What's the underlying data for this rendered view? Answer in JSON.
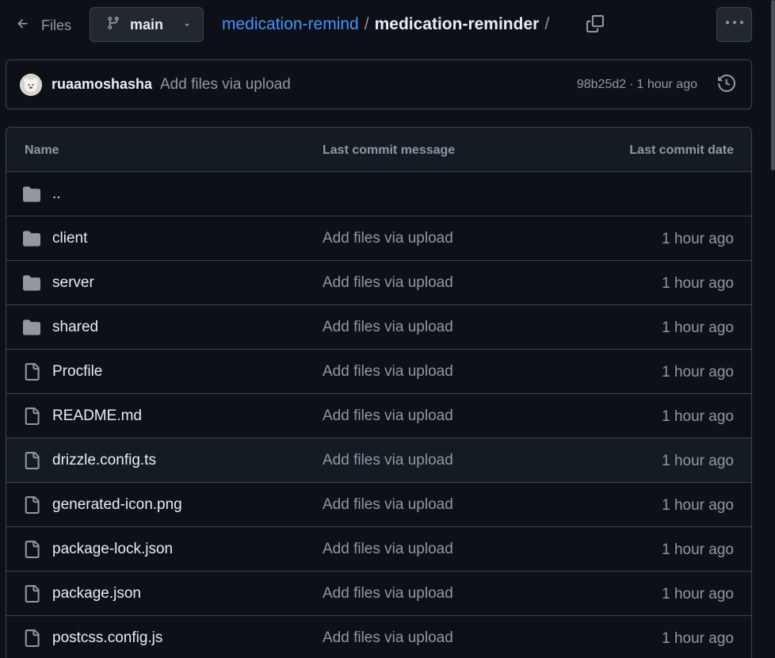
{
  "topbar": {
    "back_label": "Files",
    "branch": "main",
    "breadcrumb": {
      "repo": "medication-remind",
      "sep1": "/",
      "folder": "medication-reminder",
      "sep2": "/"
    }
  },
  "commit": {
    "author": "ruaamoshasha",
    "message": "Add files via upload",
    "sha": "98b25d2",
    "dot": "·",
    "time": "1 hour ago"
  },
  "table": {
    "headers": {
      "name": "Name",
      "message": "Last commit message",
      "date": "Last commit date"
    },
    "rows": [
      {
        "name": "..",
        "type": "folder",
        "message": "",
        "date": ""
      },
      {
        "name": "client",
        "type": "folder",
        "message": "Add files via upload",
        "date": "1 hour ago"
      },
      {
        "name": "server",
        "type": "folder",
        "message": "Add files via upload",
        "date": "1 hour ago"
      },
      {
        "name": "shared",
        "type": "folder",
        "message": "Add files via upload",
        "date": "1 hour ago"
      },
      {
        "name": "Procfile",
        "type": "file",
        "message": "Add files via upload",
        "date": "1 hour ago"
      },
      {
        "name": "README.md",
        "type": "file",
        "message": "Add files via upload",
        "date": "1 hour ago"
      },
      {
        "name": "drizzle.config.ts",
        "type": "file",
        "message": "Add files via upload",
        "date": "1 hour ago"
      },
      {
        "name": "generated-icon.png",
        "type": "file",
        "message": "Add files via upload",
        "date": "1 hour ago"
      },
      {
        "name": "package-lock.json",
        "type": "file",
        "message": "Add files via upload",
        "date": "1 hour ago"
      },
      {
        "name": "package.json",
        "type": "file",
        "message": "Add files via upload",
        "date": "1 hour ago"
      },
      {
        "name": "postcss.config.js",
        "type": "file",
        "message": "Add files via upload",
        "date": "1 hour ago"
      }
    ]
  },
  "colors": {
    "background": "#0d1117",
    "link": "#4493f8",
    "muted": "#9198a1",
    "border": "#3d444d"
  }
}
